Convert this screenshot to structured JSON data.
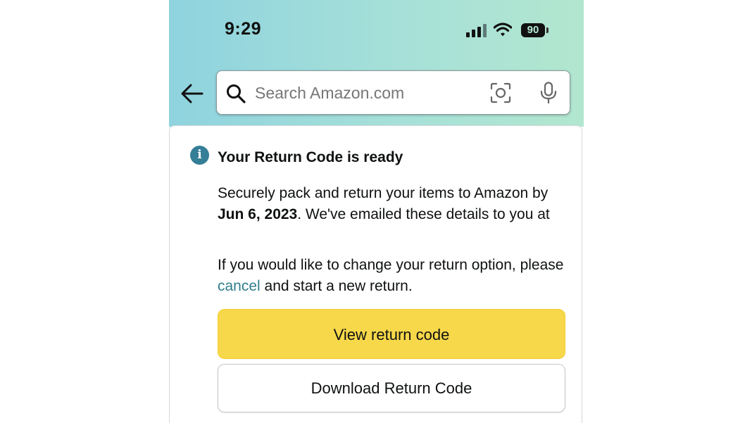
{
  "status_bar": {
    "time": "9:29",
    "battery": "90"
  },
  "search": {
    "placeholder": "Search Amazon.com"
  },
  "notice": {
    "title": "Your Return Code is ready",
    "para1_prefix": "Securely pack and return your items to Amazon by ",
    "return_date": "Jun 6, 2023",
    "para1_suffix": ". We've emailed these details to you at",
    "para2_prefix": "If you would like to change your return option, please ",
    "cancel_link": "cancel",
    "para2_suffix": " and start a new return.",
    "info_icon_glyph": "i"
  },
  "buttons": {
    "view_return_code": "View return code",
    "download_return_code": "Download Return Code"
  },
  "colors": {
    "primary_button": "#f7d84a",
    "link": "#2f7f8c",
    "info_icon": "#357e97"
  },
  "icons": [
    "back-arrow-icon",
    "search-icon",
    "camera-lens-icon",
    "microphone-icon",
    "info-icon",
    "signal-icon",
    "wifi-icon",
    "battery-icon"
  ]
}
